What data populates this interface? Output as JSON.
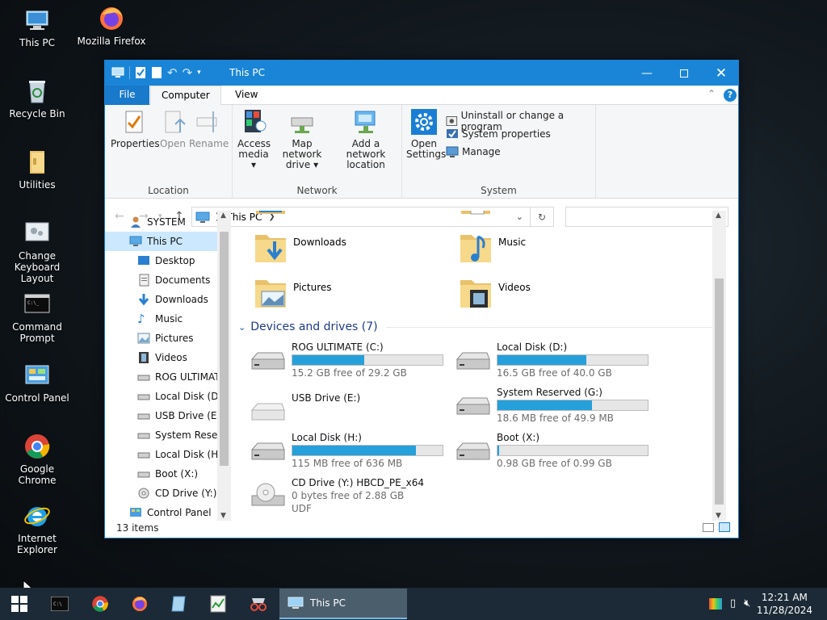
{
  "desktop": {
    "icons": [
      {
        "label": "This PC"
      },
      {
        "label": "Mozilla Firefox"
      },
      {
        "label": "Recycle Bin"
      },
      {
        "label": "Utilities"
      },
      {
        "label": "Change Keyboard Layout"
      },
      {
        "label": "Command Prompt"
      },
      {
        "label": "Control Panel"
      },
      {
        "label": "Google Chrome"
      },
      {
        "label": "Internet Explorer"
      }
    ]
  },
  "window": {
    "title": "This PC",
    "tabs": {
      "file": "File",
      "computer": "Computer",
      "view": "View"
    },
    "ribbon": {
      "location": {
        "label": "Location",
        "properties": "Properties",
        "open": "Open",
        "rename": "Rename"
      },
      "network": {
        "label": "Network",
        "access_media_1": "Access",
        "access_media_2": "media",
        "map_drive_1": "Map network",
        "map_drive_2": "drive",
        "add_location_1": "Add a network",
        "add_location_2": "location"
      },
      "system": {
        "label": "System",
        "open_settings_1": "Open",
        "open_settings_2": "Settings",
        "uninstall": "Uninstall or change a program",
        "system_properties": "System properties",
        "manage": "Manage"
      }
    },
    "address": {
      "path": "This PC"
    },
    "nav_pane": [
      {
        "label": "SYSTEM"
      },
      {
        "label": "This PC"
      },
      {
        "label": "Desktop"
      },
      {
        "label": "Documents"
      },
      {
        "label": "Downloads"
      },
      {
        "label": "Music"
      },
      {
        "label": "Pictures"
      },
      {
        "label": "Videos"
      },
      {
        "label": "ROG ULTIMATE"
      },
      {
        "label": "Local Disk (D:)"
      },
      {
        "label": "USB Drive (E:)"
      },
      {
        "label": "System Reserve"
      },
      {
        "label": "Local Disk (H:)"
      },
      {
        "label": "Boot (X:)"
      },
      {
        "label": "CD Drive (Y:) H"
      },
      {
        "label": "Control Panel"
      }
    ],
    "folders": [
      {
        "name": "Downloads"
      },
      {
        "name": "Music"
      },
      {
        "name": "Pictures"
      },
      {
        "name": "Videos"
      }
    ],
    "devices_header": "Devices and drives (7)",
    "drives": [
      {
        "name": "ROG ULTIMATE (C:)",
        "free": "15.2 GB free of 29.2 GB",
        "used_fraction": 0.48
      },
      {
        "name": "Local Disk (D:)",
        "free": "16.5 GB free of 40.0 GB",
        "used_fraction": 0.59
      },
      {
        "name": "USB Drive (E:)",
        "free": "",
        "used_fraction": null
      },
      {
        "name": "System Reserved (G:)",
        "free": "18.6 MB free of 49.9 MB",
        "used_fraction": 0.63
      },
      {
        "name": "Local Disk (H:)",
        "free": "115 MB free of 636 MB",
        "used_fraction": 0.82
      },
      {
        "name": "Boot (X:)",
        "free": "0.98 GB free of 0.99 GB",
        "used_fraction": 0.01
      },
      {
        "name": "CD Drive (Y:) HBCD_PE_x64",
        "free": "0 bytes free of 2.88 GB",
        "fs": "UDF",
        "used_fraction": null
      }
    ],
    "status": "13 items"
  },
  "taskbar": {
    "active_app": "This PC",
    "time": "12:21 AM",
    "date": "11/28/2024"
  }
}
